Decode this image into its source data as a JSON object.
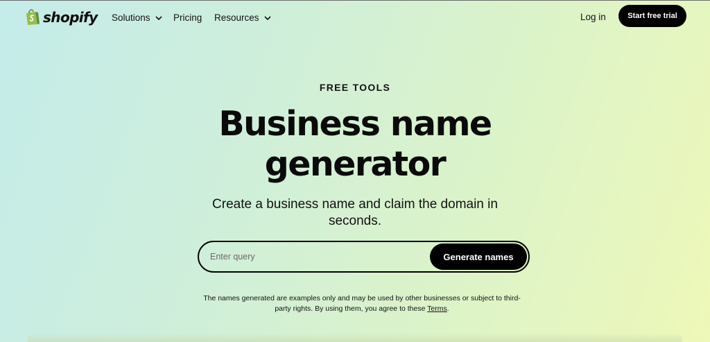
{
  "brand": {
    "name": "shopify",
    "color": "#95bf47",
    "accent": "#5e8e3e"
  },
  "nav": {
    "items": [
      {
        "label": "Solutions",
        "has_dropdown": true
      },
      {
        "label": "Pricing",
        "has_dropdown": false
      },
      {
        "label": "Resources",
        "has_dropdown": true
      }
    ],
    "login_label": "Log in",
    "cta_label": "Start free trial"
  },
  "hero": {
    "eyebrow": "FREE TOOLS",
    "title": "Business name generator",
    "subtitle": "Create a business name and claim the domain in seconds."
  },
  "search": {
    "placeholder": "Enter query",
    "value": "",
    "button_label": "Generate names"
  },
  "disclaimer": {
    "text": "The names generated are examples only and may be used by other businesses or subject to third-party rights. By using them, you agree to these ",
    "link_label": "Terms",
    "suffix": "."
  },
  "colors": {
    "text": "#0b0b0b",
    "button_bg": "#000000",
    "button_text": "#ffffff",
    "bg_start": "#c4ecea",
    "bg_end": "#eef8b8"
  },
  "icons": {
    "logo": "shopping-bag-icon",
    "dropdown": "chevron-down-icon"
  }
}
